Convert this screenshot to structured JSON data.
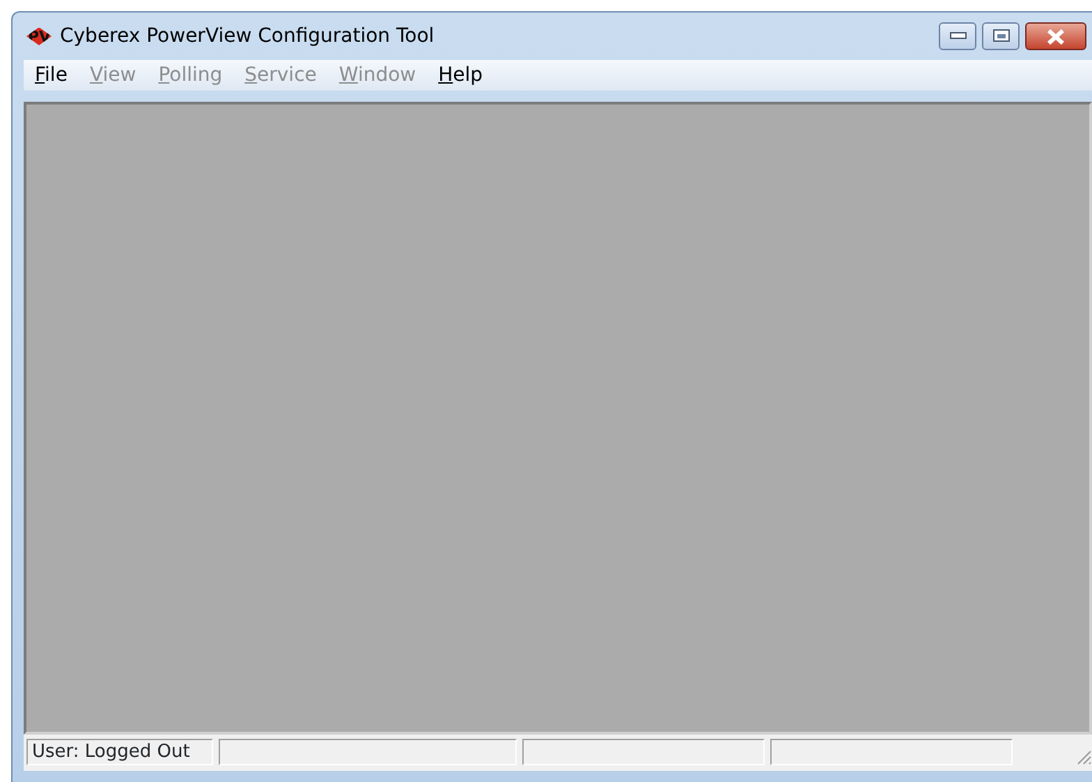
{
  "window": {
    "title": "Cyberex PowerView Configuration Tool",
    "logo": "PV"
  },
  "menu": [
    {
      "label": "File",
      "disabled": false
    },
    {
      "label": "View",
      "disabled": true
    },
    {
      "label": "Polling",
      "disabled": true
    },
    {
      "label": "Service",
      "disabled": true
    },
    {
      "label": "Window",
      "disabled": true
    },
    {
      "label": "Help",
      "disabled": false
    }
  ],
  "status_bar": [
    {
      "kind": "text",
      "text": "User: Logged Out"
    },
    {
      "kind": "empty"
    },
    {
      "kind": "empty"
    },
    {
      "kind": "empty"
    }
  ]
}
